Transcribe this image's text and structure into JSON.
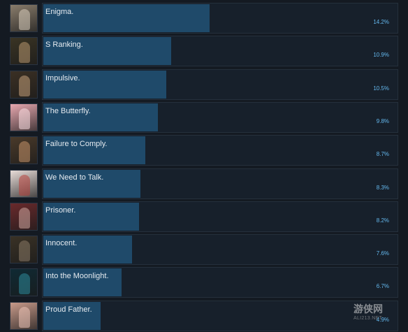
{
  "achievements": [
    {
      "name": "Enigma.",
      "percent": "14.2%",
      "fill": 0.142,
      "thumb_color": "#8a7d6c",
      "thumb_fig": "#d9cdbd"
    },
    {
      "name": "S Ranking.",
      "percent": "10.9%",
      "fill": 0.109,
      "thumb_color": "#3a3424",
      "thumb_fig": "#b89870"
    },
    {
      "name": "Impulsive.",
      "percent": "10.5%",
      "fill": 0.105,
      "thumb_color": "#3b3024",
      "thumb_fig": "#c4a07a"
    },
    {
      "name": "The Butterfly.",
      "percent": "9.8%",
      "fill": 0.098,
      "thumb_color": "#e8a8b0",
      "thumb_fig": "#fbe0e4"
    },
    {
      "name": "Failure to Comply.",
      "percent": "8.7%",
      "fill": 0.087,
      "thumb_color": "#4a3a2a",
      "thumb_fig": "#c6946a"
    },
    {
      "name": "We Need to Talk.",
      "percent": "8.3%",
      "fill": 0.083,
      "thumb_color": "#e8dcd8",
      "thumb_fig": "#b8423c"
    },
    {
      "name": "Prisoner.",
      "percent": "8.2%",
      "fill": 0.082,
      "thumb_color": "#6a2a2c",
      "thumb_fig": "#d0a8a0"
    },
    {
      "name": "Innocent.",
      "percent": "7.6%",
      "fill": 0.076,
      "thumb_color": "#3a3226",
      "thumb_fig": "#8a7a66"
    },
    {
      "name": "Into the Moonlight.",
      "percent": "6.7%",
      "fill": 0.067,
      "thumb_color": "#0f2a34",
      "thumb_fig": "#2e8a9a"
    },
    {
      "name": "Proud Father.",
      "percent": "4.9%",
      "fill": 0.049,
      "thumb_color": "#c89a8a",
      "thumb_fig": "#ecc4b8"
    }
  ],
  "watermark": {
    "main": "游侠网",
    "sub": "ALI213.NET"
  },
  "colors": {
    "bar": "#1f4a6a",
    "percent_text": "#64b8ee",
    "background": "#141a22"
  }
}
